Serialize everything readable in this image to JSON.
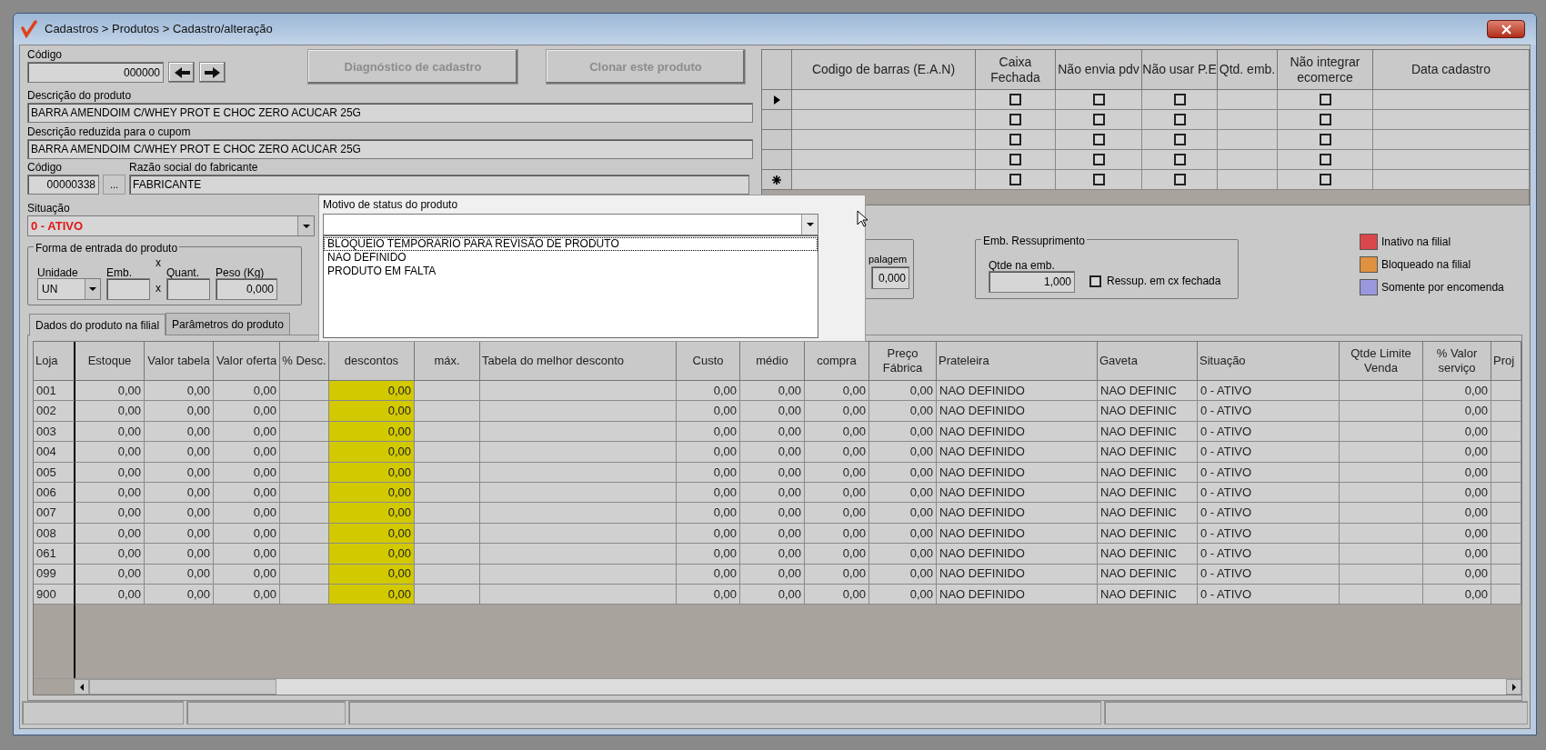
{
  "window": {
    "title": "Cadastros > Produtos > Cadastro/alteração"
  },
  "form": {
    "codigo_label": "Código",
    "codigo": "000000",
    "buttons": [
      {
        "label": "Diagnóstico de cadastro",
        "disabled": true
      },
      {
        "label": "Clonar este produto",
        "disabled": true
      }
    ],
    "descricao_label": "Descrição do produto",
    "descricao": "BARRA AMENDOIM C/WHEY PROT E CHOC ZERO ACUCAR 25G",
    "descricao_reduzida_label": "Descrição reduzida para o cupom",
    "descricao_reduzida": "BARRA AMENDOIM C/WHEY PROT E CHOC ZERO ACUCAR 25G",
    "fabricante_codigo_label": "Código",
    "fabricante_codigo": "00000338",
    "browse_button": "...",
    "fabricante_label": "Razão social do fabricante",
    "fabricante": "FABRICANTE",
    "situacao_label": "Situação",
    "situacao": "0 - ATIVO",
    "entrada": {
      "title": "Forma de entrada do produto",
      "unidade_label": "Unidade",
      "unidade": "UN",
      "emb_label": "Emb.",
      "x1": "x",
      "quant_label": "Quant.",
      "x2": "x",
      "peso_label": "Peso (Kg)",
      "peso": "0,000"
    }
  },
  "ean_grid": {
    "columns": [
      "Codigo de barras (E.A.N)",
      "Caixa Fechada",
      "Não envia pdv",
      "Não usar P.E",
      "Qtd. emb.",
      "Não integrar ecomerce",
      "Data cadastro"
    ],
    "rows": [
      {
        "kind": "current",
        "caixa_fechada": false,
        "nao_envia_pdv": false,
        "nao_usar_pe": false,
        "nao_integrar": false
      },
      {
        "kind": "blank",
        "caixa_fechada": false,
        "nao_envia_pdv": false,
        "nao_usar_pe": false,
        "nao_integrar": false
      },
      {
        "kind": "blank",
        "caixa_fechada": false,
        "nao_envia_pdv": false,
        "nao_usar_pe": false,
        "nao_integrar": false
      },
      {
        "kind": "blank",
        "caixa_fechada": false,
        "nao_envia_pdv": false,
        "nao_usar_pe": false,
        "nao_integrar": false
      },
      {
        "kind": "new",
        "caixa_fechada": false,
        "nao_envia_pdv": false,
        "nao_usar_pe": false,
        "nao_integrar": false
      }
    ]
  },
  "embalagem": {
    "label": "palagem",
    "value": "0,000"
  },
  "ressuprimento": {
    "title": "Emb. Ressuprimento",
    "qtde_label": "Qtde na emb.",
    "qtde": "1,000",
    "cx_fechada_label": "Ressup. em cx fechada",
    "cx_fechada": false
  },
  "legend": [
    {
      "label": "Inativo na filial",
      "color": "#d9474b"
    },
    {
      "label": "Bloqueado na filial",
      "color": "#e0913f"
    },
    {
      "label": "Somente por encomenda",
      "color": "#9a98dc"
    }
  ],
  "status_dropdown": {
    "label": "Motivo de status do produto",
    "options": [
      {
        "label": "BLOQUEIO TEMPORARIO PARA REVISÃO DE PRODUTO",
        "selected": true
      },
      {
        "label": "NAO DEFINIDO",
        "selected": false
      },
      {
        "label": "PRODUTO EM FALTA",
        "selected": false
      }
    ]
  },
  "tabs": [
    {
      "label": "Dados do produto na filial",
      "selected": true
    },
    {
      "label": "Parâmetros do produto",
      "selected": false
    }
  ],
  "table": {
    "columns": [
      {
        "label": "Loja",
        "kind": "id"
      },
      {
        "label": "Estoque",
        "kind": "number"
      },
      {
        "label": "Valor tabela",
        "kind": "number"
      },
      {
        "label": "Valor oferta",
        "kind": "number"
      },
      {
        "label": "% Desc.",
        "kind": "number"
      },
      {
        "label": "descontos",
        "kind": "number",
        "highlight": true
      },
      {
        "label": "máx.",
        "kind": "number"
      },
      {
        "label": "Tabela do melhor desconto",
        "kind": "text"
      },
      {
        "label": "Custo",
        "kind": "number"
      },
      {
        "label": "médio",
        "kind": "number"
      },
      {
        "label": "compra",
        "kind": "number"
      },
      {
        "label": "Preço Fábrica",
        "kind": "number"
      },
      {
        "label": "Prateleira",
        "kind": "text"
      },
      {
        "label": "Gaveta",
        "kind": "text"
      },
      {
        "label": "Situação",
        "kind": "text"
      },
      {
        "label": "Qtde Limite Venda",
        "kind": "number"
      },
      {
        "label": "% Valor serviço",
        "kind": "number"
      },
      {
        "label": "Proj",
        "kind": "text"
      }
    ],
    "rows": [
      [
        "001",
        "0,00",
        "0,00",
        "0,00",
        null,
        "0,00",
        null,
        null,
        "0,00",
        "0,00",
        "0,00",
        "0,00",
        "NAO DEFINIDO",
        "NAO DEFINIC",
        "0 - ATIVO",
        null,
        "0,00",
        null
      ],
      [
        "002",
        "0,00",
        "0,00",
        "0,00",
        null,
        "0,00",
        null,
        null,
        "0,00",
        "0,00",
        "0,00",
        "0,00",
        "NAO DEFINIDO",
        "NAO DEFINIC",
        "0 - ATIVO",
        null,
        "0,00",
        null
      ],
      [
        "003",
        "0,00",
        "0,00",
        "0,00",
        null,
        "0,00",
        null,
        null,
        "0,00",
        "0,00",
        "0,00",
        "0,00",
        "NAO DEFINIDO",
        "NAO DEFINIC",
        "0 - ATIVO",
        null,
        "0,00",
        null
      ],
      [
        "004",
        "0,00",
        "0,00",
        "0,00",
        null,
        "0,00",
        null,
        null,
        "0,00",
        "0,00",
        "0,00",
        "0,00",
        "NAO DEFINIDO",
        "NAO DEFINIC",
        "0 - ATIVO",
        null,
        "0,00",
        null
      ],
      [
        "005",
        "0,00",
        "0,00",
        "0,00",
        null,
        "0,00",
        null,
        null,
        "0,00",
        "0,00",
        "0,00",
        "0,00",
        "NAO DEFINIDO",
        "NAO DEFINIC",
        "0 - ATIVO",
        null,
        "0,00",
        null
      ],
      [
        "006",
        "0,00",
        "0,00",
        "0,00",
        null,
        "0,00",
        null,
        null,
        "0,00",
        "0,00",
        "0,00",
        "0,00",
        "NAO DEFINIDO",
        "NAO DEFINIC",
        "0 - ATIVO",
        null,
        "0,00",
        null
      ],
      [
        "007",
        "0,00",
        "0,00",
        "0,00",
        null,
        "0,00",
        null,
        null,
        "0,00",
        "0,00",
        "0,00",
        "0,00",
        "NAO DEFINIDO",
        "NAO DEFINIC",
        "0 - ATIVO",
        null,
        "0,00",
        null
      ],
      [
        "008",
        "0,00",
        "0,00",
        "0,00",
        null,
        "0,00",
        null,
        null,
        "0,00",
        "0,00",
        "0,00",
        "0,00",
        "NAO DEFINIDO",
        "NAO DEFINIC",
        "0 - ATIVO",
        null,
        "0,00",
        null
      ],
      [
        "061",
        "0,00",
        "0,00",
        "0,00",
        null,
        "0,00",
        null,
        null,
        "0,00",
        "0,00",
        "0,00",
        "0,00",
        "NAO DEFINIDO",
        "NAO DEFINIC",
        "0 - ATIVO",
        null,
        "0,00",
        null
      ],
      [
        "099",
        "0,00",
        "0,00",
        "0,00",
        null,
        "0,00",
        null,
        null,
        "0,00",
        "0,00",
        "0,00",
        "0,00",
        "NAO DEFINIDO",
        "NAO DEFINIC",
        "0 - ATIVO",
        null,
        "0,00",
        null
      ],
      [
        "900",
        "0,00",
        "0,00",
        "0,00",
        null,
        "0,00",
        null,
        null,
        "0,00",
        "0,00",
        "0,00",
        "0,00",
        "NAO DEFINIDO",
        "NAO DEFINIC",
        "0 - ATIVO",
        null,
        "0,00",
        null
      ]
    ]
  }
}
